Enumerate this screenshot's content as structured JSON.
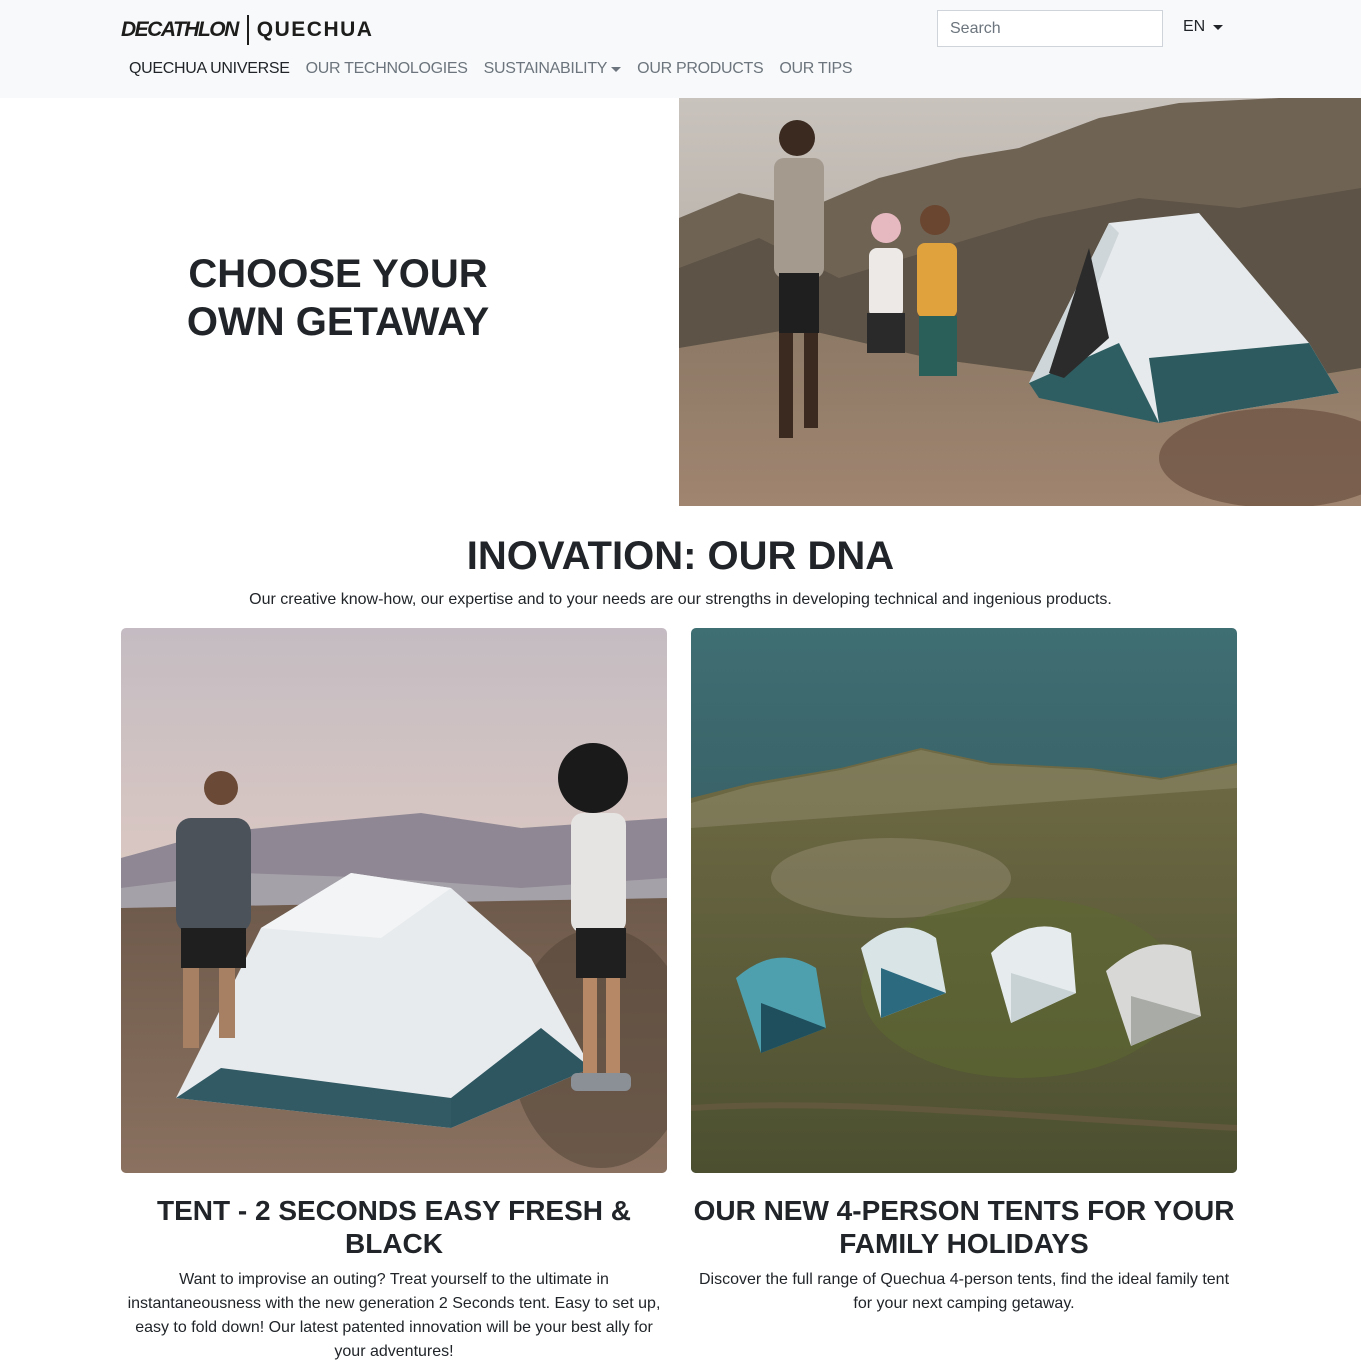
{
  "brand": {
    "primary": "DECATHLON",
    "secondary": "QUECHUA"
  },
  "nav": {
    "items": [
      {
        "label": "QUECHUA UNIVERSE",
        "active": true,
        "dropdown": false
      },
      {
        "label": "OUR TECHNOLOGIES",
        "active": false,
        "dropdown": false
      },
      {
        "label": "SUSTAINABILITY",
        "active": false,
        "dropdown": true
      },
      {
        "label": "OUR PRODUCTS",
        "active": false,
        "dropdown": false
      },
      {
        "label": "OUR TIPS",
        "active": false,
        "dropdown": false
      }
    ]
  },
  "search": {
    "placeholder": "Search",
    "value": ""
  },
  "language": {
    "selected": "EN"
  },
  "hero": {
    "title_line1": "CHOOSE YOUR",
    "title_line2": "OWN GETAWAY"
  },
  "section": {
    "title": "INOVATION: OUR DNA",
    "description": "Our creative know-how, our expertise and to your needs are our strengths in developing technical and ingenious products."
  },
  "cards": [
    {
      "title": "TENT - 2 SECONDS EASY FRESH & BLACK",
      "text": "Want to improvise an outing? Treat yourself to the ultimate in instantaneousness with the new generation 2 Seconds tent. Easy to set up, easy to fold down! Our latest patented innovation will be your best ally for your adventures!"
    },
    {
      "title": "OUR NEW 4-PERSON TENTS FOR YOUR FAMILY HOLIDAYS",
      "text": "Discover the full range of Quechua 4-person tents, find the ideal family tent for your next camping getaway."
    }
  ],
  "colors": {
    "header_bg": "#f8f9fa",
    "nav_text": "#6c757d",
    "nav_active": "#212529",
    "tent_white": "#e8ecef",
    "tent_teal": "#2e5d63"
  }
}
